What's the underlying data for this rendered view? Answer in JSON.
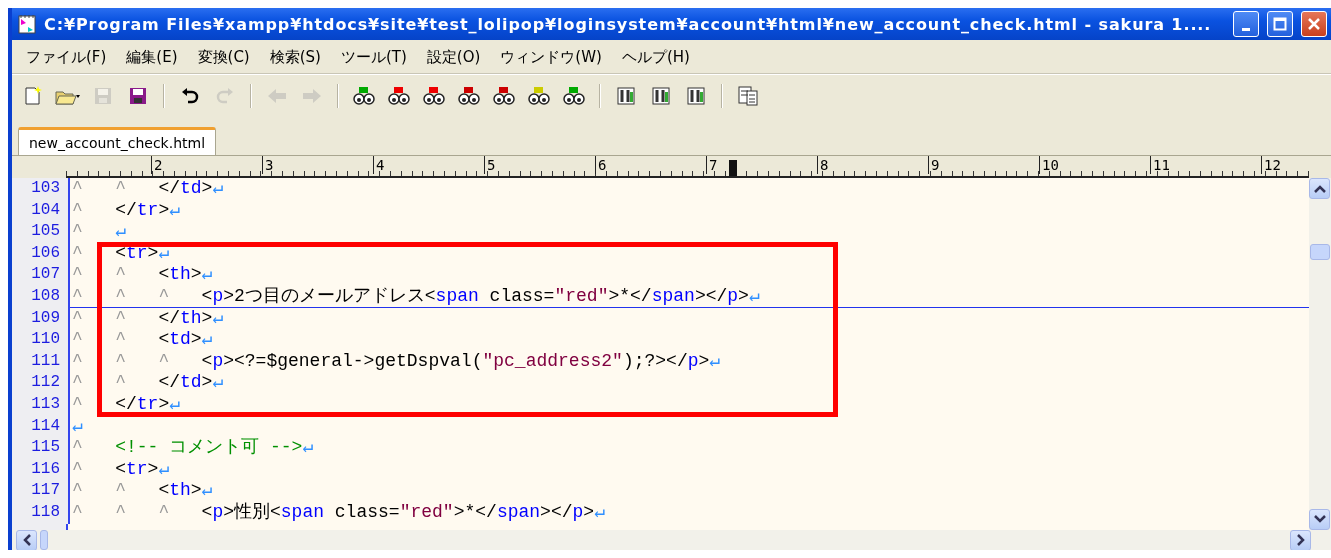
{
  "window": {
    "title": "C:¥Program Files¥xampp¥htdocs¥site¥test_lolipop¥loginsystem¥account¥html¥new_account_check.html - sakura 1...."
  },
  "menu": [
    {
      "label": "ファイル(F)"
    },
    {
      "label": "編集(E)"
    },
    {
      "label": "変換(C)"
    },
    {
      "label": "検索(S)"
    },
    {
      "label": "ツール(T)"
    },
    {
      "label": "設定(O)"
    },
    {
      "label": "ウィンドウ(W)"
    },
    {
      "label": "ヘルプ(H)"
    }
  ],
  "toolbar": [
    {
      "kind": "new",
      "disabled": false
    },
    {
      "kind": "open",
      "disabled": false
    },
    {
      "kind": "save",
      "disabled": true
    },
    {
      "kind": "save-all",
      "disabled": false
    },
    {
      "kind": "separator"
    },
    {
      "kind": "undo",
      "disabled": false
    },
    {
      "kind": "redo",
      "disabled": true
    },
    {
      "kind": "separator"
    },
    {
      "kind": "back",
      "disabled": true
    },
    {
      "kind": "forward",
      "disabled": true
    },
    {
      "kind": "separator"
    },
    {
      "kind": "find",
      "disabled": false
    },
    {
      "kind": "find-down",
      "disabled": false
    },
    {
      "kind": "find-up",
      "disabled": false
    },
    {
      "kind": "replace",
      "disabled": false
    },
    {
      "kind": "clear",
      "disabled": false
    },
    {
      "kind": "grep",
      "disabled": false
    },
    {
      "kind": "outline",
      "disabled": false
    },
    {
      "kind": "separator"
    },
    {
      "kind": "tool",
      "disabled": false
    },
    {
      "kind": "tool",
      "disabled": false
    },
    {
      "kind": "tool",
      "disabled": false
    },
    {
      "kind": "separator"
    },
    {
      "kind": "list",
      "disabled": false
    }
  ],
  "tabs": [
    {
      "label": "new_account_check.html",
      "selected": true
    }
  ],
  "ruler": {
    "labels": [
      "2",
      "3",
      "4",
      "5",
      "6",
      "7",
      "8",
      "9",
      "10",
      "11",
      "12"
    ]
  },
  "lines": [
    {
      "number": "103",
      "cursor": false,
      "boxed": false,
      "tokens": [
        {
          "kind": "tab",
          "text": "^"
        },
        {
          "kind": "tab",
          "text": "^"
        },
        {
          "kind": "plain",
          "text": "</"
        },
        {
          "kind": "tag",
          "text": "td"
        },
        {
          "kind": "plain",
          "text": ">"
        },
        {
          "kind": "eol",
          "text": "↵"
        }
      ]
    },
    {
      "number": "104",
      "cursor": false,
      "boxed": false,
      "tokens": [
        {
          "kind": "tab",
          "text": "^"
        },
        {
          "kind": "plain",
          "text": "</"
        },
        {
          "kind": "tag",
          "text": "tr"
        },
        {
          "kind": "plain",
          "text": ">"
        },
        {
          "kind": "eol",
          "text": "↵"
        }
      ]
    },
    {
      "number": "105",
      "cursor": false,
      "boxed": false,
      "tokens": [
        {
          "kind": "tab",
          "text": "^"
        },
        {
          "kind": "eol",
          "text": "↵"
        }
      ]
    },
    {
      "number": "106",
      "cursor": false,
      "boxed": true,
      "tokens": [
        {
          "kind": "tab",
          "text": "^"
        },
        {
          "kind": "plain",
          "text": "<"
        },
        {
          "kind": "tag",
          "text": "tr"
        },
        {
          "kind": "plain",
          "text": ">"
        },
        {
          "kind": "eol",
          "text": "↵"
        }
      ]
    },
    {
      "number": "107",
      "cursor": false,
      "boxed": true,
      "tokens": [
        {
          "kind": "tab",
          "text": "^"
        },
        {
          "kind": "tab",
          "text": "^"
        },
        {
          "kind": "plain",
          "text": "<"
        },
        {
          "kind": "tag",
          "text": "th"
        },
        {
          "kind": "plain",
          "text": ">"
        },
        {
          "kind": "eol",
          "text": "↵"
        }
      ]
    },
    {
      "number": "108",
      "cursor": true,
      "boxed": true,
      "tokens": [
        {
          "kind": "tab",
          "text": "^"
        },
        {
          "kind": "tab",
          "text": "^"
        },
        {
          "kind": "tab",
          "text": "^"
        },
        {
          "kind": "plain",
          "text": "<"
        },
        {
          "kind": "tag",
          "text": "p"
        },
        {
          "kind": "plain",
          "text": ">2つ目のメールアドレス<"
        },
        {
          "kind": "tag",
          "text": "span"
        },
        {
          "kind": "plain",
          "text": " class="
        },
        {
          "kind": "string",
          "text": "\"red\""
        },
        {
          "kind": "plain",
          "text": ">*</"
        },
        {
          "kind": "tag",
          "text": "span"
        },
        {
          "kind": "plain",
          "text": "></"
        },
        {
          "kind": "tag",
          "text": "p"
        },
        {
          "kind": "plain",
          "text": ">"
        },
        {
          "kind": "eol",
          "text": "↵"
        }
      ]
    },
    {
      "number": "109",
      "cursor": false,
      "boxed": true,
      "tokens": [
        {
          "kind": "tab",
          "text": "^"
        },
        {
          "kind": "tab",
          "text": "^"
        },
        {
          "kind": "plain",
          "text": "</"
        },
        {
          "kind": "tag",
          "text": "th"
        },
        {
          "kind": "plain",
          "text": ">"
        },
        {
          "kind": "eol",
          "text": "↵"
        }
      ]
    },
    {
      "number": "110",
      "cursor": false,
      "boxed": true,
      "tokens": [
        {
          "kind": "tab",
          "text": "^"
        },
        {
          "kind": "tab",
          "text": "^"
        },
        {
          "kind": "plain",
          "text": "<"
        },
        {
          "kind": "tag",
          "text": "td"
        },
        {
          "kind": "plain",
          "text": ">"
        },
        {
          "kind": "eol",
          "text": "↵"
        }
      ]
    },
    {
      "number": "111",
      "cursor": false,
      "boxed": true,
      "tokens": [
        {
          "kind": "tab",
          "text": "^"
        },
        {
          "kind": "tab",
          "text": "^"
        },
        {
          "kind": "tab",
          "text": "^"
        },
        {
          "kind": "plain",
          "text": "<"
        },
        {
          "kind": "tag",
          "text": "p"
        },
        {
          "kind": "plain",
          "text": "><?=$general->getDspval("
        },
        {
          "kind": "string",
          "text": "\"pc_address2\""
        },
        {
          "kind": "plain",
          "text": ");?></"
        },
        {
          "kind": "tag",
          "text": "p"
        },
        {
          "kind": "plain",
          "text": ">"
        },
        {
          "kind": "eol",
          "text": "↵"
        }
      ]
    },
    {
      "number": "112",
      "cursor": false,
      "boxed": true,
      "tokens": [
        {
          "kind": "tab",
          "text": "^"
        },
        {
          "kind": "tab",
          "text": "^"
        },
        {
          "kind": "plain",
          "text": "</"
        },
        {
          "kind": "tag",
          "text": "td"
        },
        {
          "kind": "plain",
          "text": ">"
        },
        {
          "kind": "eol",
          "text": "↵"
        }
      ]
    },
    {
      "number": "113",
      "cursor": false,
      "boxed": true,
      "tokens": [
        {
          "kind": "tab",
          "text": "^"
        },
        {
          "kind": "plain",
          "text": "</"
        },
        {
          "kind": "tag",
          "text": "tr"
        },
        {
          "kind": "plain",
          "text": ">"
        },
        {
          "kind": "eol",
          "text": "↵"
        }
      ]
    },
    {
      "number": "114",
      "cursor": false,
      "boxed": false,
      "tokens": [
        {
          "kind": "eol",
          "text": "↵"
        }
      ]
    },
    {
      "number": "115",
      "cursor": false,
      "boxed": false,
      "tokens": [
        {
          "kind": "tab",
          "text": "^"
        },
        {
          "kind": "comment",
          "text": "<!-- コメント可 -->"
        },
        {
          "kind": "eol",
          "text": "↵"
        }
      ]
    },
    {
      "number": "116",
      "cursor": false,
      "boxed": false,
      "tokens": [
        {
          "kind": "tab",
          "text": "^"
        },
        {
          "kind": "plain",
          "text": "<"
        },
        {
          "kind": "tag",
          "text": "tr"
        },
        {
          "kind": "plain",
          "text": ">"
        },
        {
          "kind": "eol",
          "text": "↵"
        }
      ]
    },
    {
      "number": "117",
      "cursor": false,
      "boxed": false,
      "tokens": [
        {
          "kind": "tab",
          "text": "^"
        },
        {
          "kind": "tab",
          "text": "^"
        },
        {
          "kind": "plain",
          "text": "<"
        },
        {
          "kind": "tag",
          "text": "th"
        },
        {
          "kind": "plain",
          "text": ">"
        },
        {
          "kind": "eol",
          "text": "↵"
        }
      ]
    },
    {
      "number": "118",
      "cursor": false,
      "boxed": false,
      "tokens": [
        {
          "kind": "tab",
          "text": "^"
        },
        {
          "kind": "tab",
          "text": "^"
        },
        {
          "kind": "tab",
          "text": "^"
        },
        {
          "kind": "plain",
          "text": "<"
        },
        {
          "kind": "tag",
          "text": "p"
        },
        {
          "kind": "plain",
          "text": ">性別<"
        },
        {
          "kind": "tag",
          "text": "span"
        },
        {
          "kind": "plain",
          "text": " class="
        },
        {
          "kind": "string",
          "text": "\"red\""
        },
        {
          "kind": "plain",
          "text": ">*</"
        },
        {
          "kind": "tag",
          "text": "span"
        },
        {
          "kind": "plain",
          "text": "></"
        },
        {
          "kind": "tag",
          "text": "p"
        },
        {
          "kind": "plain",
          "text": ">"
        },
        {
          "kind": "eol",
          "text": "↵"
        }
      ]
    }
  ]
}
